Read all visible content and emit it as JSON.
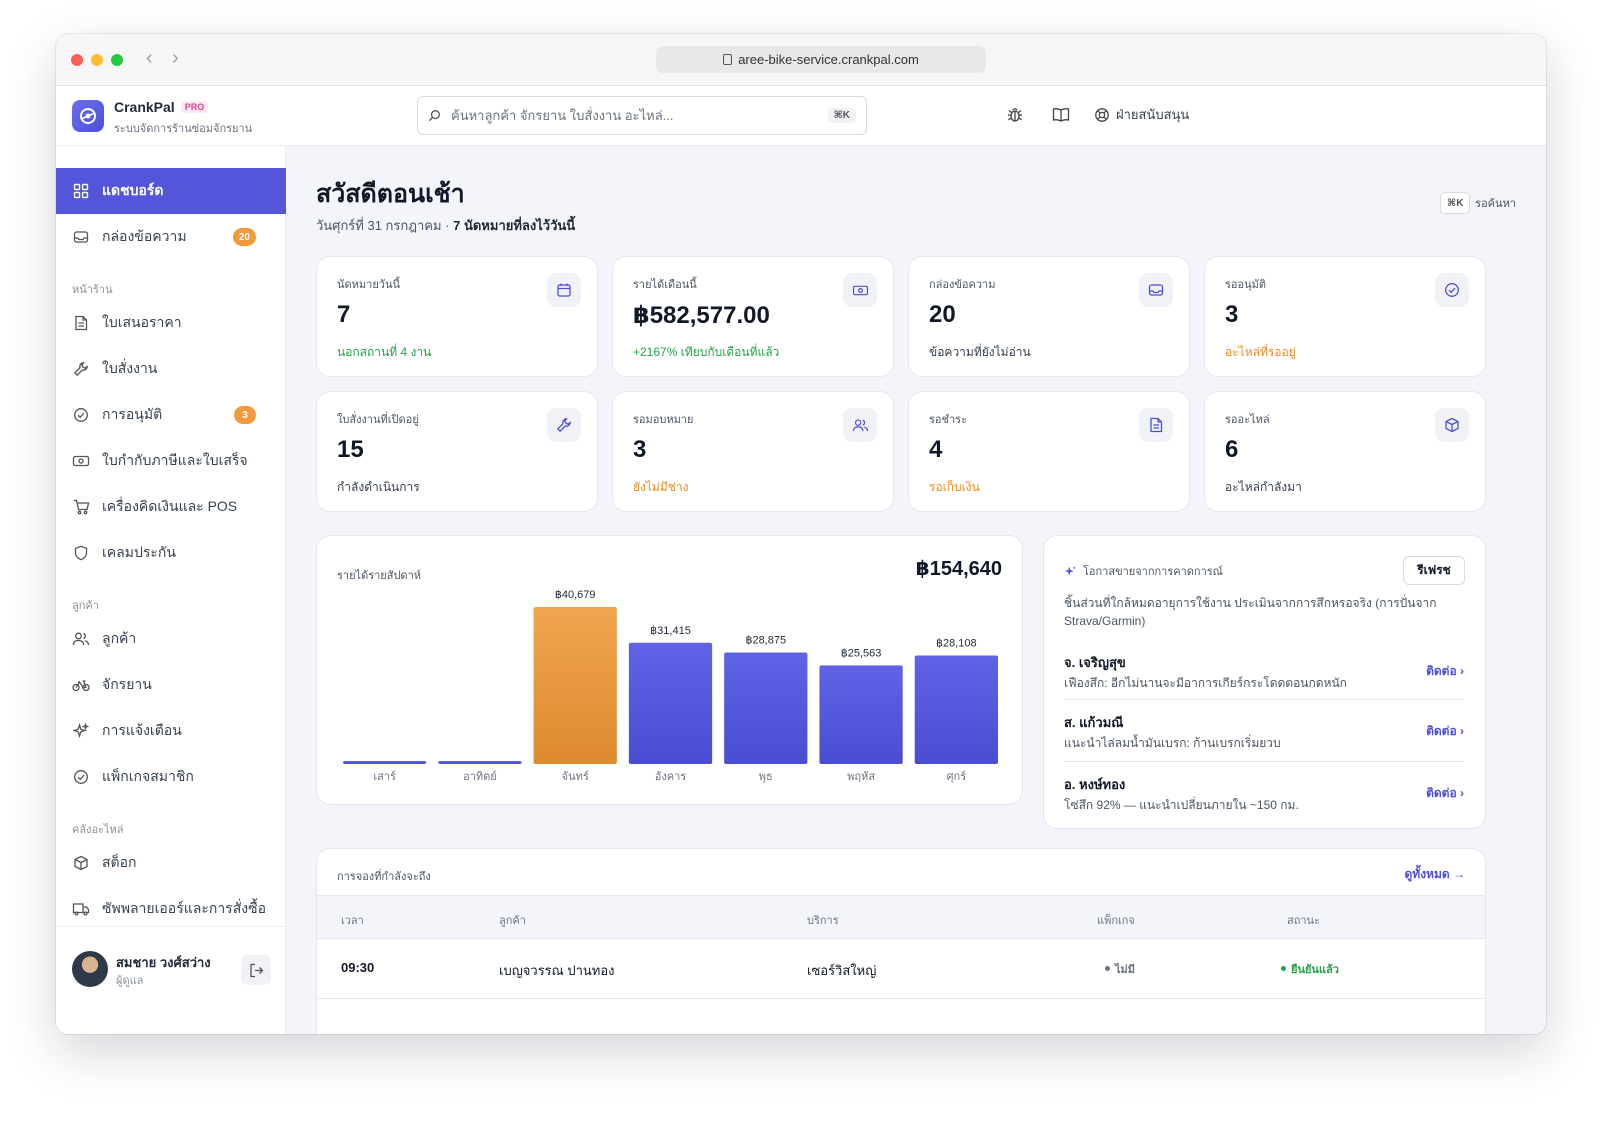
{
  "browser": {
    "url": "aree-bike-service.crankpal.com"
  },
  "brand": {
    "name": "CrankPal",
    "badge": "PRO",
    "subtitle": "ระบบจัดการร้านซ่อมจักรยาน"
  },
  "search": {
    "placeholder": "ค้นหาลูกค้า จักรยาน ใบสั่งงาน อะไหล่...",
    "shortcut": "⌘K"
  },
  "topbar": {
    "support_label": "ฝ่ายสนับสนุน"
  },
  "sidebar": {
    "items": [
      {
        "label": "แดชบอร์ด",
        "icon": "grid-icon",
        "active": true
      },
      {
        "label": "กล่องข้อความ",
        "icon": "inbox-icon",
        "badge": "20"
      },
      {
        "label": "ใบเสนอราคา",
        "icon": "document-icon"
      },
      {
        "label": "ใบสั่งงาน",
        "icon": "wrench-icon"
      },
      {
        "label": "การอนุมัติ",
        "icon": "check-circle-icon",
        "badge": "3"
      },
      {
        "label": "ใบกำกับภาษีและใบเสร็จ",
        "icon": "banknote-icon"
      },
      {
        "label": "เครื่องคิดเงินและ POS",
        "icon": "cart-icon"
      },
      {
        "label": "เคลมประกัน",
        "icon": "shield-icon"
      },
      {
        "label": "ลูกค้า",
        "icon": "users-icon"
      },
      {
        "label": "จักรยาน",
        "icon": "bike-icon"
      },
      {
        "label": "การแจ้งเตือน",
        "icon": "sparkle-icon"
      },
      {
        "label": "แพ็กเกจสมาชิก",
        "icon": "check-circle-icon"
      },
      {
        "label": "สต็อก",
        "icon": "box-icon"
      },
      {
        "label": "ซัพพลายเออร์และการสั่งซื้อ",
        "icon": "truck-icon"
      }
    ],
    "sections": {
      "shop": "หน้าร้าน",
      "customers": "ลูกค้า",
      "parts": "คลังอะไหล่"
    },
    "user": {
      "name": "สมชาย วงศ์สว่าง",
      "role": "ผู้ดูแล"
    }
  },
  "header": {
    "greeting": "สวัสดีตอนเช้า",
    "date": "วันศุกร์ที่ 31 กรกฎาคม",
    "separator": " · ",
    "appointments": "7 นัดหมายที่ลงไว้วันนี้",
    "kbd": "⌘K",
    "kbd_label": "รอค้นหา"
  },
  "stats": [
    {
      "label": "นัดหมายวันนี้",
      "value": "7",
      "note": "นอกสถานที่ 4 งาน",
      "tone": "green",
      "icon": "calendar-icon"
    },
    {
      "label": "รายได้เดือนนี้",
      "value": "฿582,577.00",
      "note": "+2167% เทียบกับเดือนที่แล้ว",
      "tone": "green",
      "icon": "banknote-icon"
    },
    {
      "label": "กล่องข้อความ",
      "value": "20",
      "note": "ข้อความที่ยังไม่อ่าน",
      "tone": "plain",
      "icon": "inbox-icon"
    },
    {
      "label": "รออนุมัติ",
      "value": "3",
      "note": "อะไหล่ที่รออยู่",
      "tone": "orange",
      "icon": "check-circle-icon"
    },
    {
      "label": "ใบสั่งงานที่เปิดอยู่",
      "value": "15",
      "note": "กำลังดำเนินการ",
      "tone": "plain",
      "icon": "wrench-icon"
    },
    {
      "label": "รอมอบหมาย",
      "value": "3",
      "note": "ยังไม่มีช่าง",
      "tone": "orange",
      "icon": "users-icon"
    },
    {
      "label": "รอชำระ",
      "value": "4",
      "note": "รอเก็บเงิน",
      "tone": "orange",
      "icon": "document-icon"
    },
    {
      "label": "รออะไหล่",
      "value": "6",
      "note": "อะไหล่กำลังมา",
      "tone": "plain",
      "icon": "box-icon"
    }
  ],
  "chart_data": {
    "type": "bar",
    "title": "รายได้รายสัปดาห์",
    "total_label": "฿154,640",
    "categories": [
      "เสาร์",
      "อาทิตย์",
      "จันทร์",
      "อังคาร",
      "พุธ",
      "พฤหัส",
      "ศุกร์"
    ],
    "values": [
      0,
      0,
      40679,
      31415,
      28875,
      25563,
      28108
    ],
    "value_labels": [
      "",
      "",
      "฿40,679",
      "฿31,415",
      "฿28,875",
      "฿25,563",
      "฿28,108"
    ],
    "highlight_index": 2,
    "colors": {
      "bar": "#5558dc",
      "highlight": "#eea04a"
    },
    "ylim": [
      0,
      40679
    ]
  },
  "ai": {
    "title": "โอกาสขายจากการคาดการณ์",
    "refresh": "รีเฟรช",
    "description": "ชิ้นส่วนที่ใกล้หมดอายุการใช้งาน ประเมินจากการสึกหรอจริง (การปั่นจาก Strava/Garmin)",
    "items": [
      {
        "name": "จ. เจริญสุข",
        "detail": "เฟืองสึก: อีกไม่นานจะมีอาการเกียร์กระโดดตอนกดหนัก",
        "action": "ติดต่อ ›"
      },
      {
        "name": "ส. แก้วมณี",
        "detail": "แนะนำไล่ลมน้ำมันเบรก: ก้านเบรกเริ่มยวบ",
        "action": "ติดต่อ ›"
      },
      {
        "name": "อ. หงษ์ทอง",
        "detail": "โซ่สึก 92% — แนะนำเปลี่ยนภายใน ~150 กม.",
        "action": "ติดต่อ ›"
      }
    ]
  },
  "bookings": {
    "title": "การจองที่กำลังจะถึง",
    "view_all": "ดูทั้งหมด →",
    "columns": [
      "เวลา",
      "ลูกค้า",
      "บริการ",
      "แพ็กเกจ",
      "สถานะ"
    ],
    "rows": [
      {
        "time": "09:30",
        "customer": "เบญจวรรณ ปานทอง",
        "service": "เซอร์วิสใหญ่",
        "package": "ไม่มี",
        "status": "ยืนยันแล้ว"
      }
    ]
  }
}
